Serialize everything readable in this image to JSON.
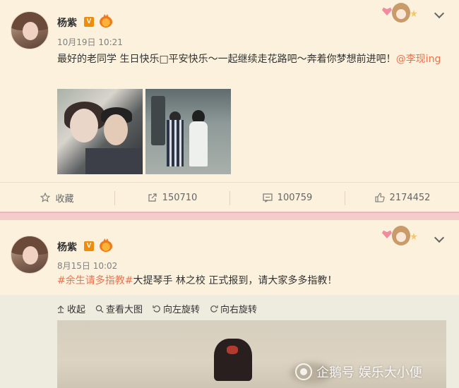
{
  "posts": [
    {
      "author": "杨紫",
      "verified_badge": "V",
      "timestamp": "10月19日 10:21",
      "text": "最好的老同学 生日快乐□平安快乐～一起继续走花路吧～奔着你梦想前进吧！",
      "mention": "@李现ing",
      "image_count": 2
    },
    {
      "author": "杨紫",
      "verified_badge": "V",
      "timestamp": "8月15日 10:02",
      "hashtag": "#余生请多指教#",
      "text": "大提琴手 林之校 正式报到，请大家多多指教！"
    }
  ],
  "actions": {
    "favorite_label": "收藏",
    "repost_count": "150710",
    "comment_count": "100759",
    "like_count": "2174452"
  },
  "image_tools": {
    "collapse": "收起",
    "view_large": "查看大图",
    "rotate_left": "向左旋转",
    "rotate_right": "向右旋转"
  },
  "watermark": "企鹅号 娱乐大小便",
  "colors": {
    "background": "#fbf1dc",
    "link": "#eb7350",
    "divider": "#f3cccb",
    "verified": "#f08c0c"
  },
  "icons": [
    "star-icon",
    "share-icon",
    "comment-icon",
    "thumbs-up-icon",
    "chevron-down-icon",
    "zoom-icon",
    "rotate-left-icon",
    "rotate-right-icon",
    "collapse-icon"
  ]
}
